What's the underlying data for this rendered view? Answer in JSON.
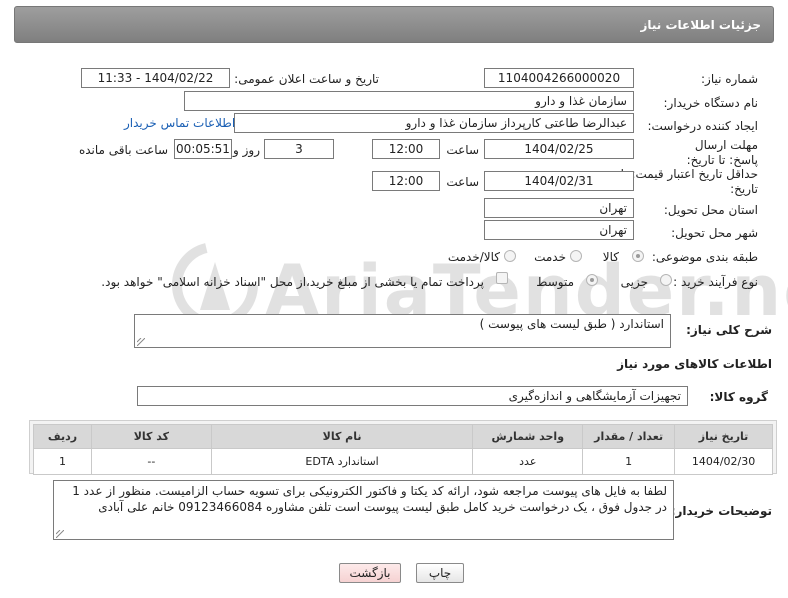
{
  "header": {
    "title": "جزئیات اطلاعات نیاز"
  },
  "watermark": {
    "text": "AriaTender.neT"
  },
  "form": {
    "need_number_label": "شماره نیاز:",
    "need_number": "1104004266000020",
    "announce_label": "تاریخ و ساعت اعلان عمومی:",
    "announce_value": "1404/02/22 - 11:33",
    "buyer_org_label": "نام دستگاه خریدار:",
    "buyer_org": "سازمان غذا و دارو",
    "creator_label": "ایجاد کننده درخواست:",
    "creator": "عبدالرضا طاعتی کارپرداز سازمان غذا و دارو",
    "contact_link": "اطلاعات تماس خریدار",
    "deadline_label": "مهلت ارسال پاسخ: تا تاریخ:",
    "deadline_date": "1404/02/25",
    "time_label": "ساعت",
    "deadline_time": "12:00",
    "days_value": "3",
    "days_label": "روز و",
    "remaining_value": "00:05:51",
    "remaining_label": "ساعت باقی مانده",
    "price_validity_label": "حداقل تاریخ اعتبار قیمت: تا تاریخ:",
    "price_date": "1404/02/31",
    "price_time": "12:00",
    "province_label": "استان محل تحویل:",
    "province": "تهران",
    "city_label": "شهر محل تحویل:",
    "city": "تهران",
    "category_label": "طبقه بندی موضوعی:",
    "category_options": [
      "کالا",
      "خدمت",
      "کالا/خدمت"
    ],
    "process_label": "نوع فرآیند خرید :",
    "process_options": [
      "جزیی",
      "متوسط"
    ],
    "payment_note": "پرداخت تمام یا بخشی از مبلغ خرید،از محل \"اسناد خزانه اسلامی\" خواهد بود."
  },
  "description": {
    "label": "شرح کلی نیاز:",
    "value": "استاندارد ( طبق لیست های پیوست )"
  },
  "goods": {
    "section_title": "اطلاعات کالاهای مورد نیاز",
    "group_label": "گروه کالا:",
    "group_value": "تجهیزات آزمایشگاهی و اندازه‌گیری",
    "columns": [
      "ردیف",
      "کد کالا",
      "نام کالا",
      "واحد شمارش",
      "تعداد / مقدار",
      "تاریخ نیاز"
    ],
    "rows": [
      [
        "1",
        "--",
        "استاندارد EDTA",
        "عدد",
        "1",
        "1404/02/30"
      ]
    ]
  },
  "buyer_notes": {
    "label": "توضیحات خریدار:",
    "text": "لطفا به فایل های پیوست مراجعه شود، ارائه کد یکتا و فاکتور الکترونیکی برای تسویه حساب الزامیست. منظور از عدد 1  در جدول فوق ، یک درخواست خرید کامل طبق لیست پیوست است تلفن مشاوره 09123466084 خانم علی آبادی"
  },
  "buttons": {
    "print": "چاپ",
    "back": "بازگشت"
  },
  "colors": {
    "header_bg": "#8c8c8c",
    "link": "#1a5fb4",
    "table_header": "#d8d8d8",
    "back_button": "#f6d2d2"
  }
}
